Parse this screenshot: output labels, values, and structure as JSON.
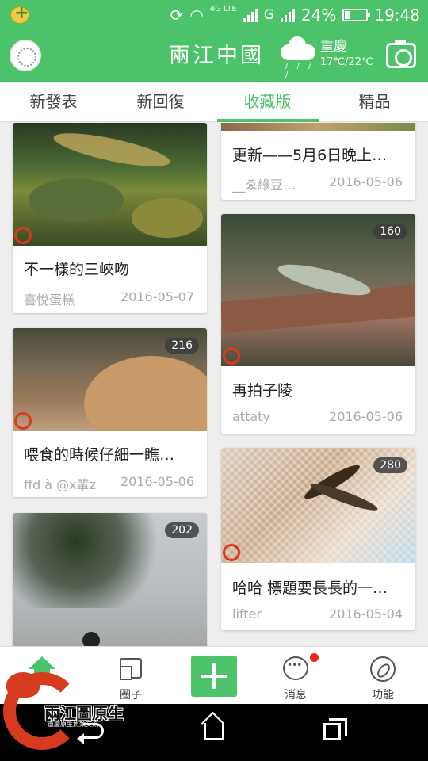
{
  "status_bar": {
    "network_type": "4G LTE",
    "carrier_g": "G",
    "battery": "24%",
    "battery_fraction": 0.24,
    "time": "19:48"
  },
  "header": {
    "title": "兩江中國",
    "weather": {
      "city": "重慶",
      "temp": "17℃/22℃",
      "icon": "cloud-rain-icon"
    }
  },
  "tabs": [
    {
      "label": "新發表",
      "active": false
    },
    {
      "label": "新回復",
      "active": false
    },
    {
      "label": "收藏版",
      "active": true
    },
    {
      "label": "精品",
      "active": false
    }
  ],
  "posts_left": [
    {
      "title": "不一樣的三峽吻",
      "author": "喜悅蛋糕",
      "date": "2016-05-07",
      "views": ""
    },
    {
      "title": "喂食的時候仔細一瞧…",
      "author": "ffd à @x輩z",
      "date": "2016-05-06",
      "views": "216"
    },
    {
      "title": "",
      "author": "",
      "date": "",
      "views": "202"
    }
  ],
  "posts_right": [
    {
      "title": "更新——5月6日晚上…",
      "author": "__ゑ綠豆…",
      "date": "2016-05-06",
      "views": ""
    },
    {
      "title": "再拍子陵",
      "author": "attaty",
      "date": "2016-05-06",
      "views": "160"
    },
    {
      "title": "哈哈 標題要長長的一…",
      "author": "lifter",
      "date": "2016-05-04",
      "views": "280"
    }
  ],
  "bottom_nav": {
    "home": "",
    "circle": "圈子",
    "add": "",
    "messages": "消息",
    "functions": "功能"
  },
  "logo": {
    "text": "兩江圖原生",
    "url": "www.cqlnjqo.com",
    "sub": "重慶原生魚類交流"
  },
  "colors": {
    "brand": "#4cc36a",
    "badge_dot": "#e8261d"
  }
}
